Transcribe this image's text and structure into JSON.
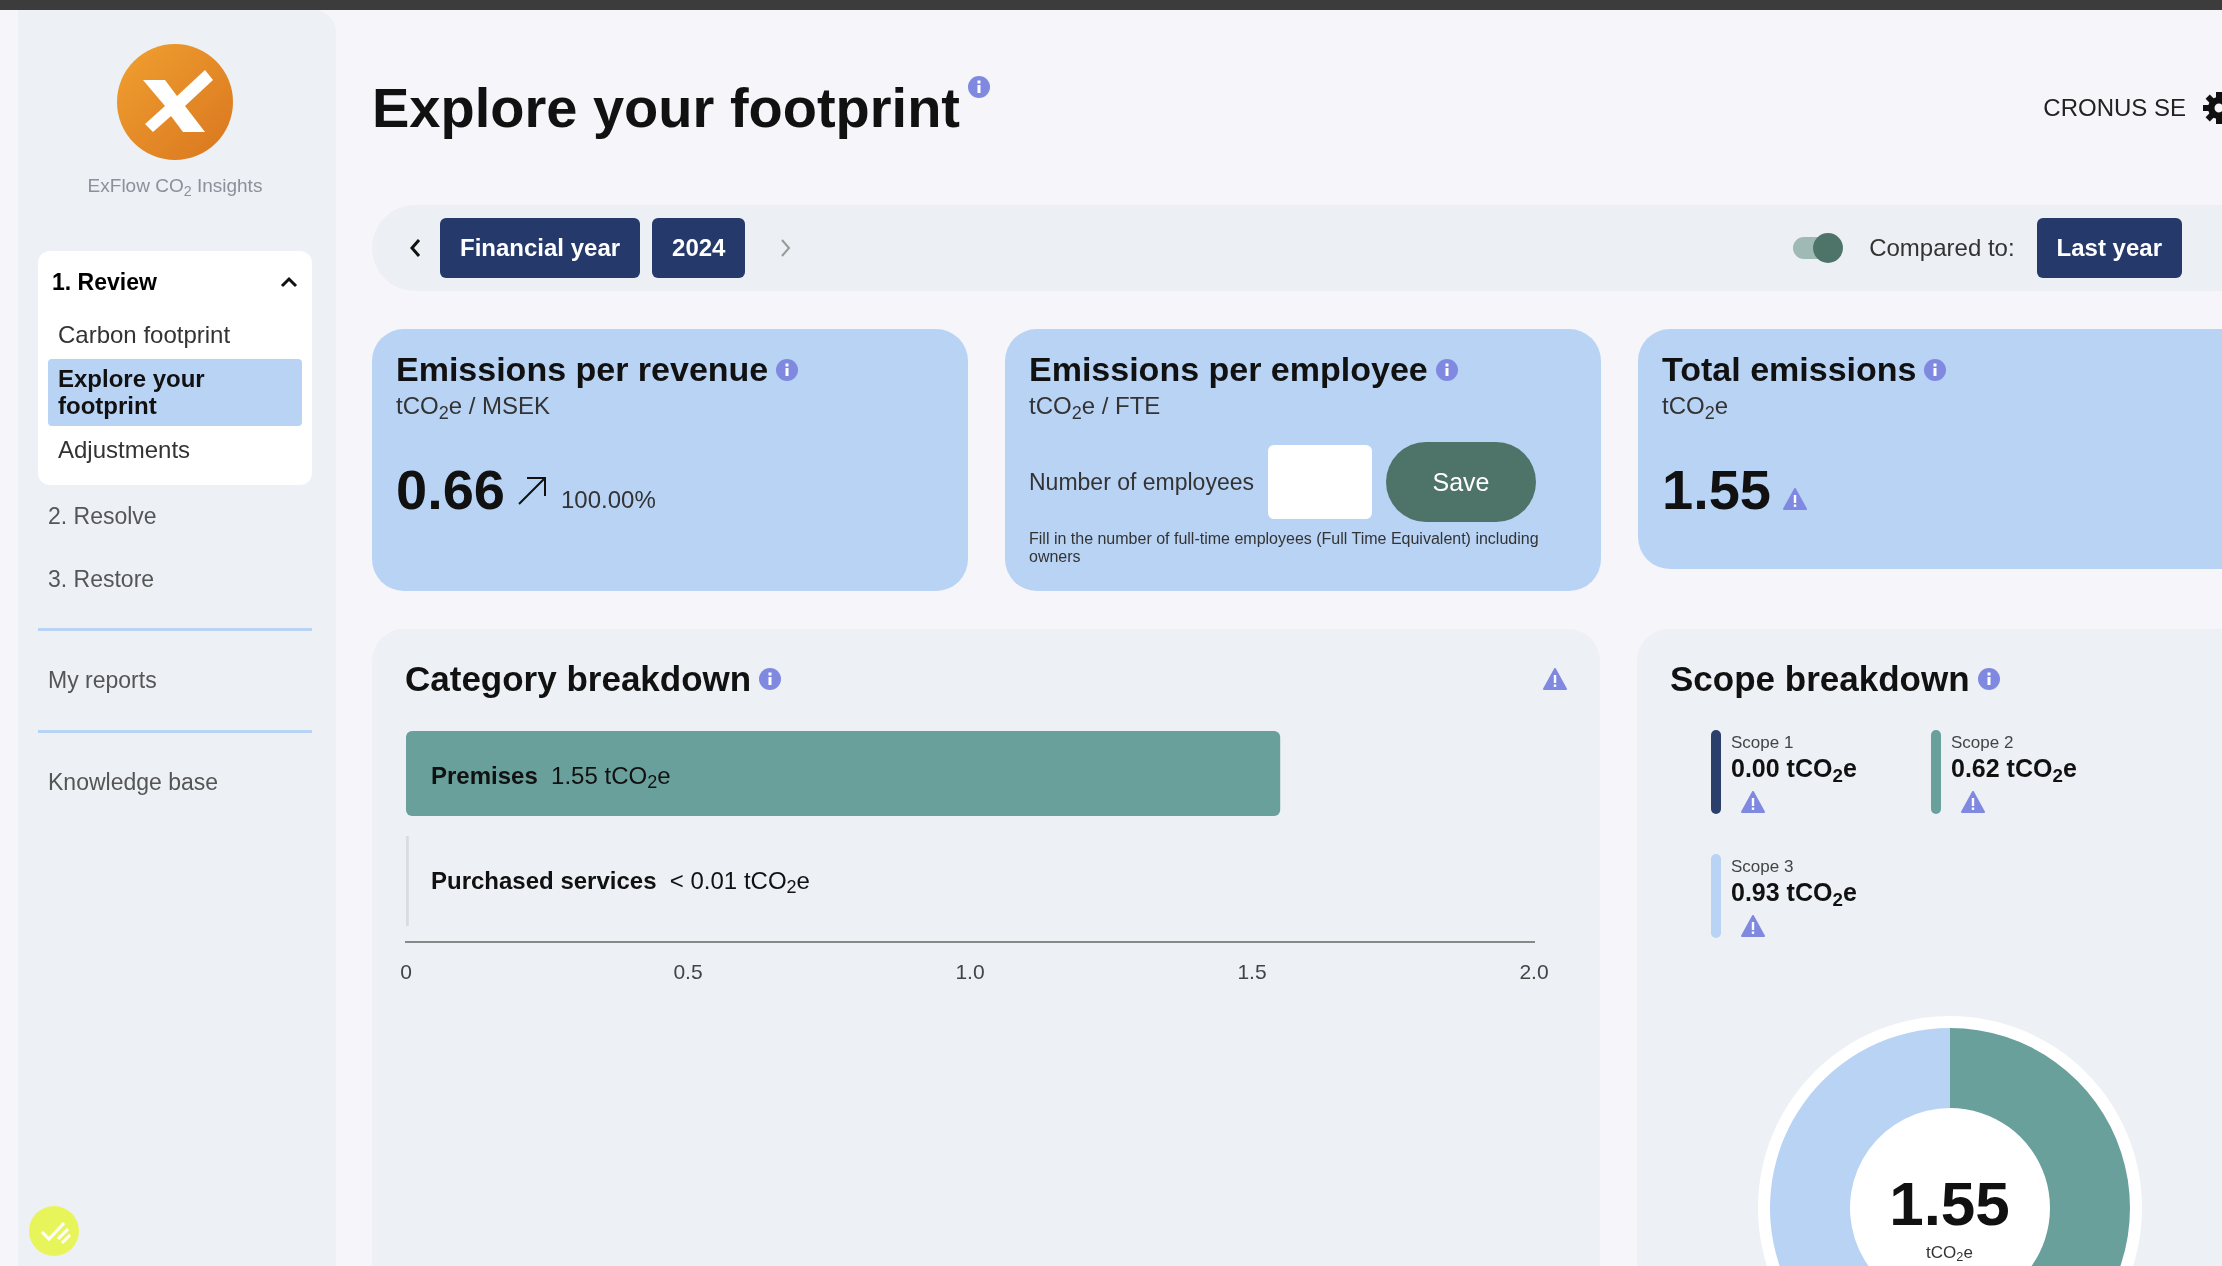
{
  "sidebar": {
    "logo_text": "ExFlow CO$_{2}$ Insights",
    "sections": [
      {
        "label": "1. Review",
        "expanded": true,
        "children": [
          {
            "label": "Carbon footprint",
            "selected": false
          },
          {
            "label": "Explore your footprint",
            "selected": true
          },
          {
            "label": "Adjustments",
            "selected": false
          }
        ]
      },
      {
        "label": "2. Resolve",
        "expanded": false
      },
      {
        "label": "3. Restore",
        "expanded": false
      }
    ],
    "links": [
      "My reports",
      "Knowledge base"
    ]
  },
  "header": {
    "title": "Explore your footprint",
    "company": "CRONUS SE"
  },
  "period_bar": {
    "period_type": "Financial year",
    "year": "2024",
    "compare_toggle": {
      "on": true
    },
    "compare_label": "Compared to:",
    "compare_value": "Last year"
  },
  "cards": [
    {
      "kind": "metric",
      "title": "Emissions per revenue",
      "unit": "tCO$_{2}$e / MSEK",
      "value": "0.66",
      "change": "100.00%",
      "warning": false
    },
    {
      "kind": "employees",
      "title": "Emissions per employee",
      "unit": "tCO$_{2}$e / FTE",
      "field_label": "Number of employees",
      "button": "Save",
      "hint": "Fill in the number of full-time employees (Full Time Equivalent) including owners"
    },
    {
      "kind": "metric",
      "title": "Total emissions",
      "unit": "tCO$_{2}$e",
      "value": "1.55",
      "warning": true
    }
  ],
  "category_breakdown": {
    "title": "Category breakdown",
    "warning": true,
    "bar_values": [
      "1.55 tCO$_{2}$e",
      "< 0.01 tCO$_{2}$e"
    ],
    "chart_data": {
      "type": "bar",
      "orientation": "horizontal",
      "categories": [
        "Premises",
        "Purchased services"
      ],
      "values": [
        1.55,
        0.005
      ],
      "xlim": [
        0,
        2
      ],
      "xticks": [
        {
          "value": 0,
          "label": "0"
        },
        {
          "value": 0.5,
          "label": "0.5"
        },
        {
          "value": 1,
          "label": "1.0"
        },
        {
          "value": 1.5,
          "label": "1.5"
        },
        {
          "value": 2,
          "label": "2.0"
        }
      ]
    }
  },
  "scope_breakdown": {
    "title": "Scope breakdown",
    "scopes": [
      {
        "value": "0.00 tCO$_{2}$e",
        "color": "#2b3f6b",
        "warning": true
      },
      {
        "value": "0.62 tCO$_{2}$e",
        "color": "#69a09c",
        "warning": true
      },
      {
        "value": "0.93 tCO$_{2}$e",
        "color": "#b9d3f5",
        "warning": true
      }
    ],
    "total": "1.55",
    "total_unit": "tCO$_{2}$e",
    "chart_data": {
      "type": "donut",
      "categories": [
        "Scope 1",
        "Scope 2",
        "Scope 3"
      ],
      "values": [
        0,
        40,
        60
      ]
    }
  }
}
